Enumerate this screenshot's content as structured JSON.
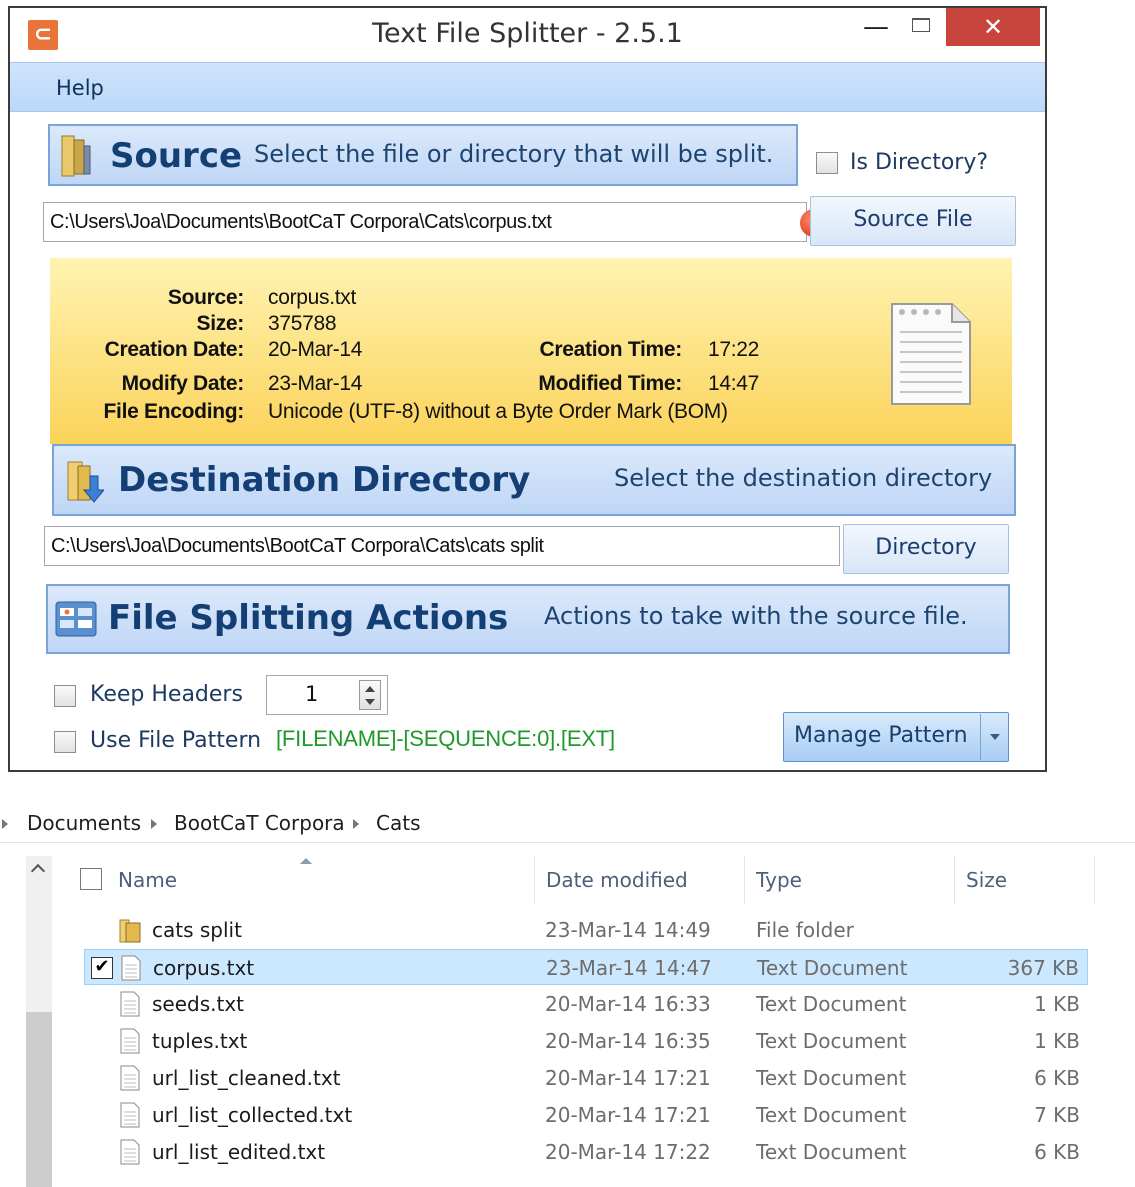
{
  "window": {
    "title": "Text File Splitter - 2.5.1",
    "min_glyph": "—",
    "close_glyph": "✕"
  },
  "menu": {
    "help": "Help"
  },
  "source": {
    "title": "Source",
    "subtitle": "Select the file or directory that will be split.",
    "is_directory_label": "Is Directory?",
    "path": "C:\\Users\\Joa\\Documents\\BootCaT Corpora\\Cats\\corpus.txt",
    "error_glyph": "!",
    "button": "Source File"
  },
  "info": {
    "source_label": "Source:",
    "source_value": "corpus.txt",
    "size_label": "Size:",
    "size_value": "375788",
    "creation_date_label": "Creation Date:",
    "creation_date_value": "20-Mar-14",
    "creation_time_label": "Creation Time:",
    "creation_time_value": "17:22",
    "modify_date_label": "Modify Date:",
    "modify_date_value": "23-Mar-14",
    "modified_time_label": "Modified Time:",
    "modified_time_value": "14:47",
    "encoding_label": "File Encoding:",
    "encoding_value": "Unicode (UTF-8) without a Byte Order Mark (BOM)"
  },
  "destination": {
    "title": "Destination Directory",
    "subtitle": "Select the destination directory",
    "path": "C:\\Users\\Joa\\Documents\\BootCaT Corpora\\Cats\\cats split",
    "button": "Directory"
  },
  "actions": {
    "title": "File Splitting Actions",
    "subtitle": "Actions to take with the source file.",
    "keep_headers_label": "Keep Headers",
    "keep_headers_value": "1",
    "use_pattern_label": "Use File Pattern",
    "pattern_value": "[FILENAME]-[SEQUENCE:0].[EXT]",
    "manage_pattern_button": "Manage Pattern"
  },
  "explorer": {
    "breadcrumb": [
      "Documents",
      "BootCaT Corpora",
      "Cats"
    ],
    "columns": {
      "name": "Name",
      "date": "Date modified",
      "type": "Type",
      "size": "Size"
    },
    "rows": [
      {
        "name": "cats split",
        "date": "23-Mar-14 14:49",
        "type": "File folder",
        "size": "",
        "icon": "folder-icon"
      },
      {
        "name": "corpus.txt",
        "date": "23-Mar-14 14:47",
        "type": "Text Document",
        "size": "367 KB",
        "icon": "text-file-icon",
        "check": "✔"
      },
      {
        "name": "seeds.txt",
        "date": "20-Mar-14 16:33",
        "type": "Text Document",
        "size": "1 KB",
        "icon": "text-file-icon"
      },
      {
        "name": "tuples.txt",
        "date": "20-Mar-14 16:35",
        "type": "Text Document",
        "size": "1 KB",
        "icon": "text-file-icon"
      },
      {
        "name": "url_list_cleaned.txt",
        "date": "20-Mar-14 17:21",
        "type": "Text Document",
        "size": "6 KB",
        "icon": "text-file-icon"
      },
      {
        "name": "url_list_collected.txt",
        "date": "20-Mar-14 17:21",
        "type": "Text Document",
        "size": "7 KB",
        "icon": "text-file-icon"
      },
      {
        "name": "url_list_edited.txt",
        "date": "20-Mar-14 17:22",
        "type": "Text Document",
        "size": "6 KB",
        "icon": "text-file-icon"
      }
    ]
  },
  "colors": {
    "accent": "#7aa4d8",
    "info_panel": "#fbd35a",
    "close_button": "#c7453c",
    "pattern_text": "#1f9a2a",
    "selection": "#cce8ff"
  }
}
